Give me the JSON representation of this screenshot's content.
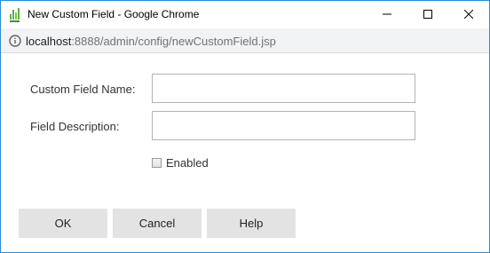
{
  "window": {
    "title": "New Custom Field - Google Chrome",
    "accent_color": "#2b8ad6"
  },
  "address_bar": {
    "url_host": "localhost",
    "url_rest": ":8888/admin/config/newCustomField.jsp"
  },
  "form": {
    "custom_field_name_label": "Custom Field Name:",
    "custom_field_name_value": "",
    "field_description_label": "Field Description:",
    "field_description_value": "",
    "enabled_label": "Enabled",
    "enabled_checked": false
  },
  "buttons": {
    "ok_label": "OK",
    "cancel_label": "Cancel",
    "help_label": "Help"
  }
}
